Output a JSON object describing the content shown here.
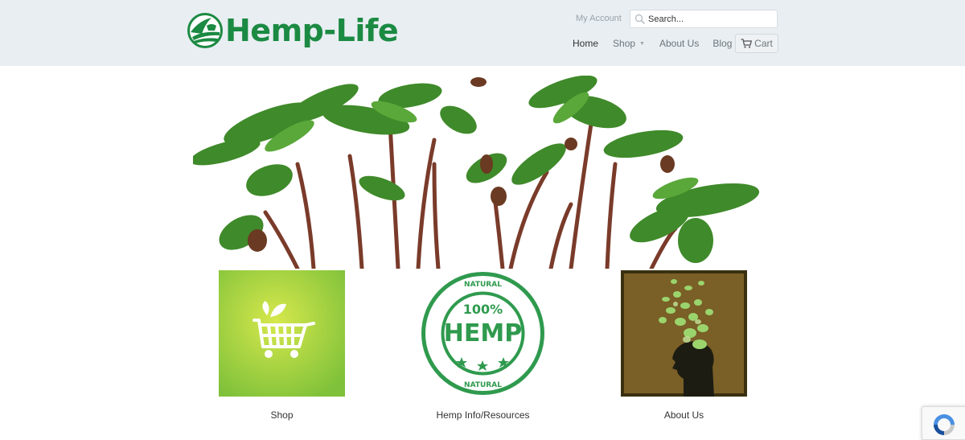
{
  "header": {
    "logo_text": "Hemp-Life",
    "my_account": "My Account",
    "search_placeholder": "Search...",
    "nav": {
      "home": "Home",
      "shop": "Shop",
      "about": "About Us",
      "blog": "Blog"
    },
    "cart_label": "Cart"
  },
  "tiles": {
    "shop": {
      "label": "Shop",
      "icon": "shopping-cart-icon"
    },
    "hemp": {
      "label": "Hemp Info/Resources",
      "stamp_big": "HEMP",
      "stamp_small": "100%",
      "stamp_ring": "NATURAL"
    },
    "about": {
      "label": "About Us",
      "icon": "head-leaves-icon"
    }
  },
  "colors": {
    "brand_green": "#1b8a42",
    "header_bg": "#e8eef2",
    "shop_tile": "#8cc63f",
    "about_tile": "#7a5f27"
  }
}
